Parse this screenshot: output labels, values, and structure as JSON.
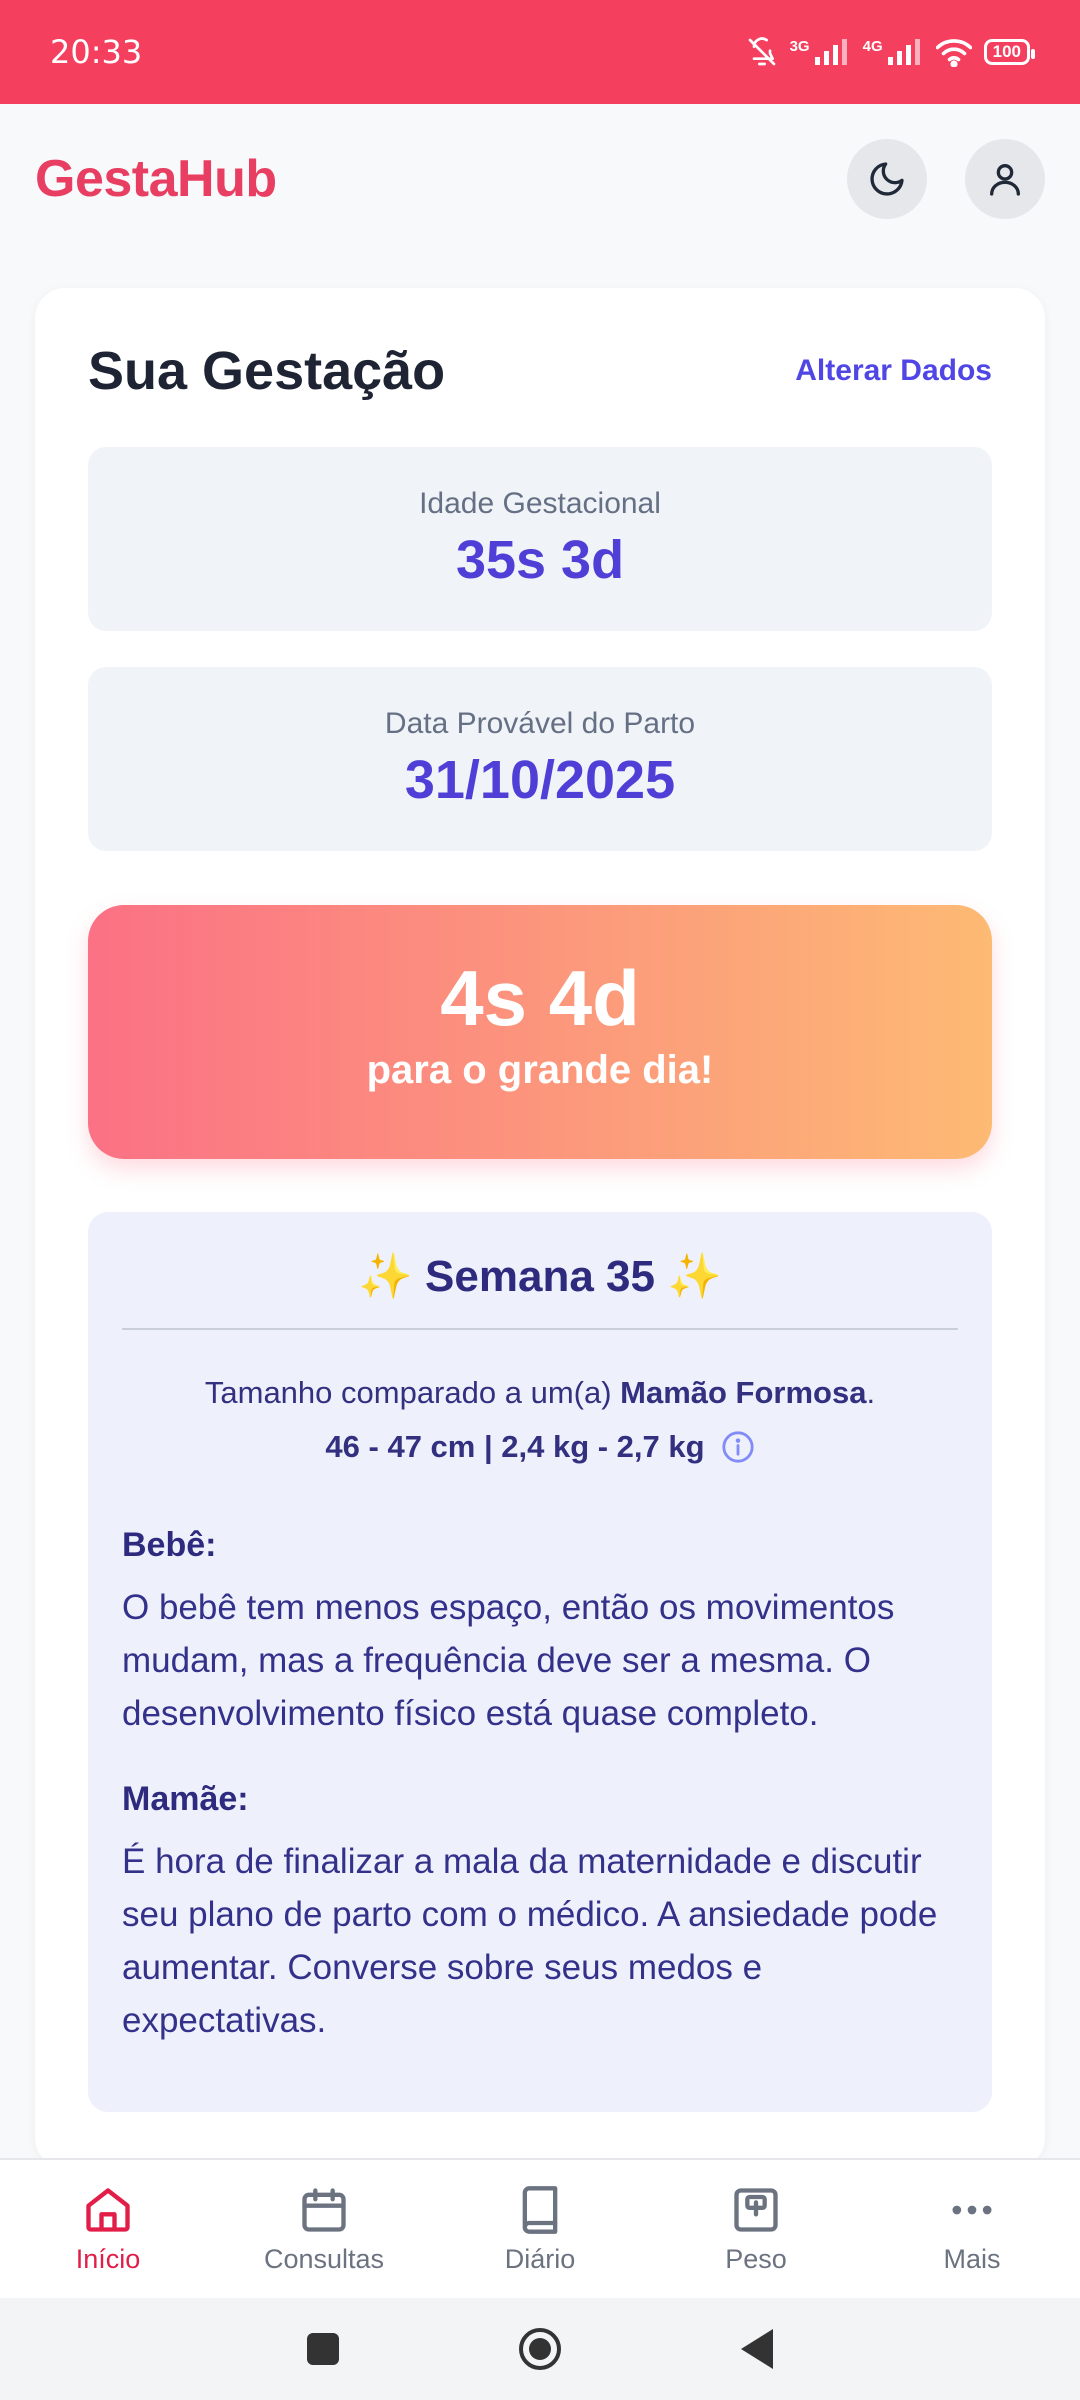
{
  "status_bar": {
    "time": "20:33",
    "signal_1_label": "3G",
    "signal_2_label": "4G",
    "battery": "100",
    "icons": [
      "mute-bell-icon",
      "signal-icon",
      "signal-icon",
      "wifi-icon",
      "battery-icon"
    ]
  },
  "app": {
    "brand": "GestaHub",
    "theme_toggle_icon": "moon-icon",
    "profile_icon": "user-icon"
  },
  "pregnancy_card": {
    "title": "Sua Gestação",
    "edit_link": "Alterar Dados",
    "gestational_age": {
      "label": "Idade Gestacional",
      "value": "35s 3d"
    },
    "due_date": {
      "label": "Data Provável do Parto",
      "value": "31/10/2025"
    },
    "countdown": {
      "value": "4s 4d",
      "caption": "para o grande dia!"
    }
  },
  "week_info": {
    "spark_left": "✨",
    "title": "Semana 35",
    "spark_right": "✨",
    "compare_prefix": "Tamanho comparado a um(a) ",
    "fruit": "Mamão Formosa",
    "compare_suffix": ".",
    "measurements": "46 - 47 cm | 2,4 kg - 2,7 kg",
    "baby_label": "Bebê:",
    "baby_text": "O bebê tem menos espaço, então os movimentos mudam, mas a frequência deve ser a mesma. O desenvolvimento físico está quase completo.",
    "mom_label": "Mamãe:",
    "mom_text": "É hora de finalizar a mala da maternidade e discutir seu plano de parto com o médico. A ansiedade pode aumentar. Converse sobre seus medos e expectativas."
  },
  "bottom_nav": {
    "items": [
      {
        "label": "Início",
        "icon": "home-icon",
        "active": true
      },
      {
        "label": "Consultas",
        "icon": "calendar-icon",
        "active": false
      },
      {
        "label": "Diário",
        "icon": "book-icon",
        "active": false
      },
      {
        "label": "Peso",
        "icon": "scale-icon",
        "active": false
      },
      {
        "label": "Mais",
        "icon": "more-icon",
        "active": false
      }
    ]
  },
  "colors": {
    "status_bar": "#f43f5e",
    "brand": "#e83e62",
    "accent": "#4f46e5",
    "countdown_start": "#fb7185",
    "countdown_end": "#fdba74",
    "nav_active": "#e11d48"
  }
}
